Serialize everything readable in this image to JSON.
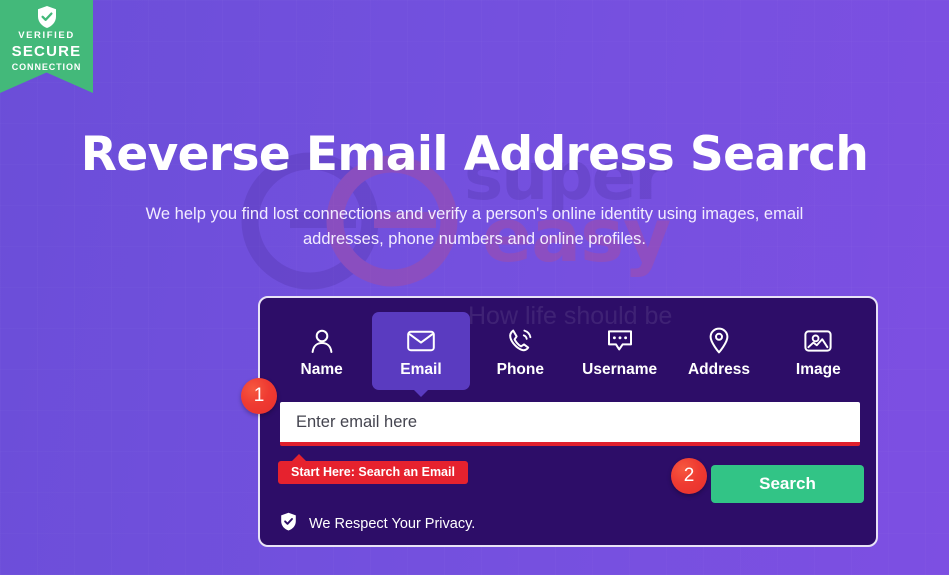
{
  "theme": {
    "bg_gradient_from": "#6b4ed8",
    "bg_gradient_to": "#7d4fe2",
    "card_bg": "#2d0d68",
    "accent_green": "#32c486",
    "accent_red": "#e6222e",
    "badge_green": "#43b97a",
    "active_tab_bg": "#5a3bc0"
  },
  "badge": {
    "icon": "shield-check-icon",
    "line1": "VERIFIED",
    "line2": "SECURE",
    "line3": "CONNECTION"
  },
  "watermark": {
    "logo": "super-easy-rings-logo",
    "word1": "super",
    "word2": "easy",
    "tagline": "How life should be",
    "card_tagline": "How life should be"
  },
  "hero": {
    "title": "Reverse Email Address Search",
    "subtitle": "We help you find lost connections and verify a person's online identity using images, email addresses, phone numbers and online profiles."
  },
  "search_card": {
    "tabs": [
      {
        "label": "Name",
        "icon": "person-icon",
        "active": false
      },
      {
        "label": "Email",
        "icon": "envelope-icon",
        "active": true
      },
      {
        "label": "Phone",
        "icon": "phone-ring-icon",
        "active": false
      },
      {
        "label": "Username",
        "icon": "chat-bubble-icon",
        "active": false
      },
      {
        "label": "Address",
        "icon": "map-pin-icon",
        "active": false
      },
      {
        "label": "Image",
        "icon": "picture-icon",
        "active": false
      }
    ],
    "input": {
      "placeholder": "Enter email here",
      "value": ""
    },
    "callout": "Start Here: Search an Email",
    "search_button": "Search",
    "privacy": {
      "icon": "shield-check-icon",
      "label": "We Respect Your Privacy."
    }
  },
  "steps": [
    {
      "number": "1"
    },
    {
      "number": "2"
    }
  ]
}
